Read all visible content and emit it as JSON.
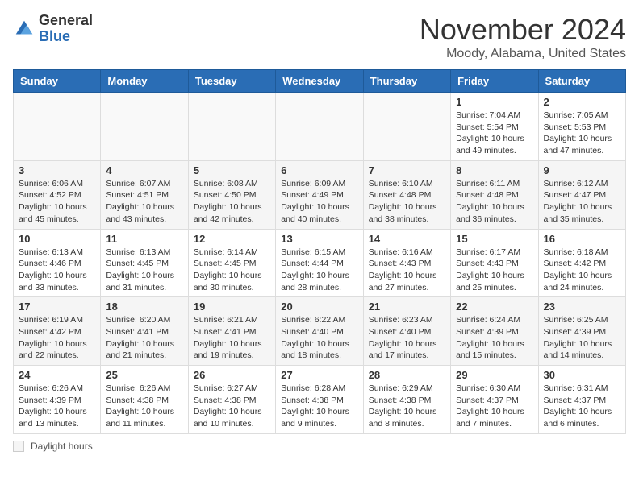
{
  "header": {
    "logo_general": "General",
    "logo_blue": "Blue",
    "month_title": "November 2024",
    "location": "Moody, Alabama, United States"
  },
  "weekdays": [
    "Sunday",
    "Monday",
    "Tuesday",
    "Wednesday",
    "Thursday",
    "Friday",
    "Saturday"
  ],
  "weeks": [
    [
      {
        "day": "",
        "info": ""
      },
      {
        "day": "",
        "info": ""
      },
      {
        "day": "",
        "info": ""
      },
      {
        "day": "",
        "info": ""
      },
      {
        "day": "",
        "info": ""
      },
      {
        "day": "1",
        "info": "Sunrise: 7:04 AM\nSunset: 5:54 PM\nDaylight: 10 hours and 49 minutes."
      },
      {
        "day": "2",
        "info": "Sunrise: 7:05 AM\nSunset: 5:53 PM\nDaylight: 10 hours and 47 minutes."
      }
    ],
    [
      {
        "day": "3",
        "info": "Sunrise: 6:06 AM\nSunset: 4:52 PM\nDaylight: 10 hours and 45 minutes."
      },
      {
        "day": "4",
        "info": "Sunrise: 6:07 AM\nSunset: 4:51 PM\nDaylight: 10 hours and 43 minutes."
      },
      {
        "day": "5",
        "info": "Sunrise: 6:08 AM\nSunset: 4:50 PM\nDaylight: 10 hours and 42 minutes."
      },
      {
        "day": "6",
        "info": "Sunrise: 6:09 AM\nSunset: 4:49 PM\nDaylight: 10 hours and 40 minutes."
      },
      {
        "day": "7",
        "info": "Sunrise: 6:10 AM\nSunset: 4:48 PM\nDaylight: 10 hours and 38 minutes."
      },
      {
        "day": "8",
        "info": "Sunrise: 6:11 AM\nSunset: 4:48 PM\nDaylight: 10 hours and 36 minutes."
      },
      {
        "day": "9",
        "info": "Sunrise: 6:12 AM\nSunset: 4:47 PM\nDaylight: 10 hours and 35 minutes."
      }
    ],
    [
      {
        "day": "10",
        "info": "Sunrise: 6:13 AM\nSunset: 4:46 PM\nDaylight: 10 hours and 33 minutes."
      },
      {
        "day": "11",
        "info": "Sunrise: 6:13 AM\nSunset: 4:45 PM\nDaylight: 10 hours and 31 minutes."
      },
      {
        "day": "12",
        "info": "Sunrise: 6:14 AM\nSunset: 4:45 PM\nDaylight: 10 hours and 30 minutes."
      },
      {
        "day": "13",
        "info": "Sunrise: 6:15 AM\nSunset: 4:44 PM\nDaylight: 10 hours and 28 minutes."
      },
      {
        "day": "14",
        "info": "Sunrise: 6:16 AM\nSunset: 4:43 PM\nDaylight: 10 hours and 27 minutes."
      },
      {
        "day": "15",
        "info": "Sunrise: 6:17 AM\nSunset: 4:43 PM\nDaylight: 10 hours and 25 minutes."
      },
      {
        "day": "16",
        "info": "Sunrise: 6:18 AM\nSunset: 4:42 PM\nDaylight: 10 hours and 24 minutes."
      }
    ],
    [
      {
        "day": "17",
        "info": "Sunrise: 6:19 AM\nSunset: 4:42 PM\nDaylight: 10 hours and 22 minutes."
      },
      {
        "day": "18",
        "info": "Sunrise: 6:20 AM\nSunset: 4:41 PM\nDaylight: 10 hours and 21 minutes."
      },
      {
        "day": "19",
        "info": "Sunrise: 6:21 AM\nSunset: 4:41 PM\nDaylight: 10 hours and 19 minutes."
      },
      {
        "day": "20",
        "info": "Sunrise: 6:22 AM\nSunset: 4:40 PM\nDaylight: 10 hours and 18 minutes."
      },
      {
        "day": "21",
        "info": "Sunrise: 6:23 AM\nSunset: 4:40 PM\nDaylight: 10 hours and 17 minutes."
      },
      {
        "day": "22",
        "info": "Sunrise: 6:24 AM\nSunset: 4:39 PM\nDaylight: 10 hours and 15 minutes."
      },
      {
        "day": "23",
        "info": "Sunrise: 6:25 AM\nSunset: 4:39 PM\nDaylight: 10 hours and 14 minutes."
      }
    ],
    [
      {
        "day": "24",
        "info": "Sunrise: 6:26 AM\nSunset: 4:39 PM\nDaylight: 10 hours and 13 minutes."
      },
      {
        "day": "25",
        "info": "Sunrise: 6:26 AM\nSunset: 4:38 PM\nDaylight: 10 hours and 11 minutes."
      },
      {
        "day": "26",
        "info": "Sunrise: 6:27 AM\nSunset: 4:38 PM\nDaylight: 10 hours and 10 minutes."
      },
      {
        "day": "27",
        "info": "Sunrise: 6:28 AM\nSunset: 4:38 PM\nDaylight: 10 hours and 9 minutes."
      },
      {
        "day": "28",
        "info": "Sunrise: 6:29 AM\nSunset: 4:38 PM\nDaylight: 10 hours and 8 minutes."
      },
      {
        "day": "29",
        "info": "Sunrise: 6:30 AM\nSunset: 4:37 PM\nDaylight: 10 hours and 7 minutes."
      },
      {
        "day": "30",
        "info": "Sunrise: 6:31 AM\nSunset: 4:37 PM\nDaylight: 10 hours and 6 minutes."
      }
    ]
  ],
  "footer": {
    "legend_label": "Daylight hours"
  }
}
